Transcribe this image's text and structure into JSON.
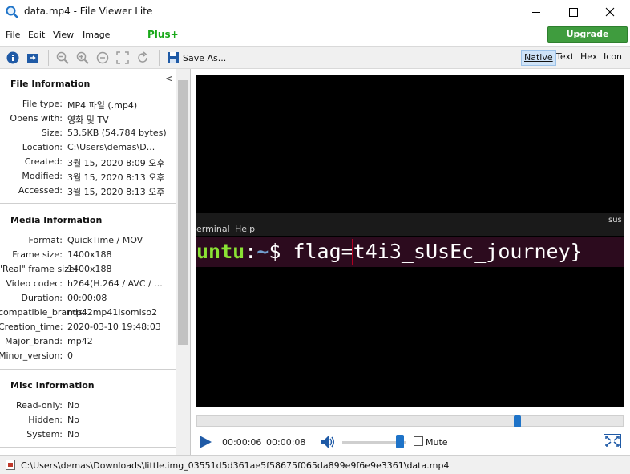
{
  "window": {
    "title": "data.mp4 - File Viewer Lite"
  },
  "menu": {
    "items": [
      "File",
      "Edit",
      "View",
      "Image"
    ],
    "plus_label": "Plus+",
    "upgrade_label": "Upgrade"
  },
  "toolbar": {
    "save_as_label": "Save As...",
    "view_tabs": [
      "Native",
      "Text",
      "Hex",
      "Icon"
    ],
    "active_view": "Native",
    "icons": [
      "info-icon",
      "open-in-icon",
      "zoom-out-icon",
      "zoom-in-icon",
      "zoom-reset-icon",
      "fit-icon",
      "rotate-icon",
      "save-icon"
    ]
  },
  "sidebar": {
    "collapse_glyph": "<",
    "sections": [
      {
        "title": "File Information",
        "rows": [
          {
            "label": "File type:",
            "value": "MP4 파일 (.mp4)"
          },
          {
            "label": "Opens with:",
            "value": "영화 및 TV"
          },
          {
            "label": "Size:",
            "value": "53.5KB (54,784 bytes)"
          },
          {
            "label": "Location:",
            "value": "C:\\Users\\demas\\D..."
          },
          {
            "label": "Created:",
            "value": "3월 15, 2020 8:09 오후"
          },
          {
            "label": "Modified:",
            "value": "3월 15, 2020 8:13 오후"
          },
          {
            "label": "Accessed:",
            "value": "3월 15, 2020 8:13 오후"
          }
        ]
      },
      {
        "title": "Media Information",
        "rows": [
          {
            "label": "Format:",
            "value": "QuickTime / MOV"
          },
          {
            "label": "Frame size:",
            "value": "1400x188"
          },
          {
            "label": "\"Real\" frame size:",
            "value": "1400x188"
          },
          {
            "label": "Video codec:",
            "value": "h264(H.264 / AVC / ..."
          },
          {
            "label": "Duration:",
            "value": "00:00:08"
          },
          {
            "label": "compatible_brands:",
            "value": "mp42mp41isomiso2"
          },
          {
            "label": "Creation_time:",
            "value": "2020-03-10 19:48:03"
          },
          {
            "label": "Major_brand:",
            "value": "mp42"
          },
          {
            "label": "Minor_version:",
            "value": "0"
          }
        ]
      },
      {
        "title": "Misc Information",
        "rows": [
          {
            "label": "Read-only:",
            "value": "No"
          },
          {
            "label": "Hidden:",
            "value": "No"
          },
          {
            "label": "System:",
            "value": "No"
          }
        ]
      }
    ]
  },
  "video": {
    "terminal_menu": [
      "erminal",
      "Help"
    ],
    "terminal_right": "sus",
    "prompt_user": "untu",
    "prompt_sep": ":",
    "prompt_path": "~",
    "prompt_cmd": "$ flag=t4i3_sUsEc_journey}"
  },
  "player": {
    "current_time": "00:00:06",
    "duration": "00:00:08",
    "progress": 0.75,
    "volume": 0.9,
    "mute_label": "Mute",
    "muted": false
  },
  "status": {
    "path": "C:\\Users\\demas\\Downloads\\little.img_03551d5d361ae5f58675f065da899e9f6e9e3361\\data.mp4"
  },
  "colors": {
    "upgrade": "#3f9c3e",
    "plus": "#19a819",
    "accent": "#1e73c8",
    "terminal_bg": "#2c0b1e",
    "prompt_user": "#8ae234",
    "prompt_path": "#729fcf"
  }
}
